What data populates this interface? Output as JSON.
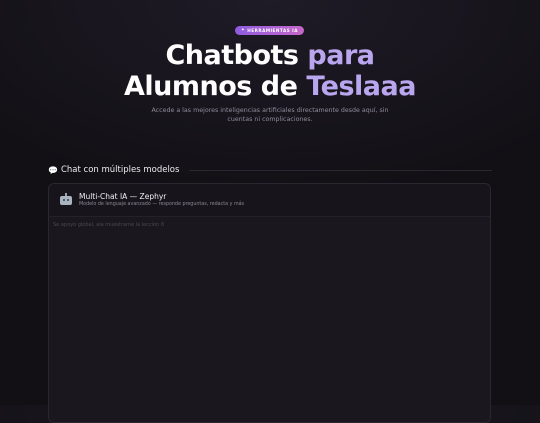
{
  "badge": {
    "star": "✦",
    "label": "HERRAMIENTAS IA"
  },
  "hero": {
    "line1_plain": "Chatbots ",
    "line1_accent": "para",
    "line2_plain": "Alumnos de ",
    "line2_accent": "Teslaaa",
    "subtitle": "Accede a las mejores inteligencias artificiales directamente desde aquí, sin cuentas ni complicaciones."
  },
  "section": {
    "icon": "speech-bubble-icon",
    "icon_glyph": "💬",
    "title": "Chat con múltiples modelos"
  },
  "chat": {
    "icon": "robot-icon",
    "title": "Multi-Chat IA — Zephyr",
    "description": "Modelo de lenguaje avanzado — responde preguntas, redacta y más",
    "input_placeholder": "Se apoyó global, ala muestrame la lección 8"
  },
  "colors": {
    "background": "#121015",
    "accent_text": "#b9a6ee",
    "badge_gradient_start": "#8e5ce0",
    "badge_gradient_end": "#c766c9",
    "panel": "#17151b"
  }
}
